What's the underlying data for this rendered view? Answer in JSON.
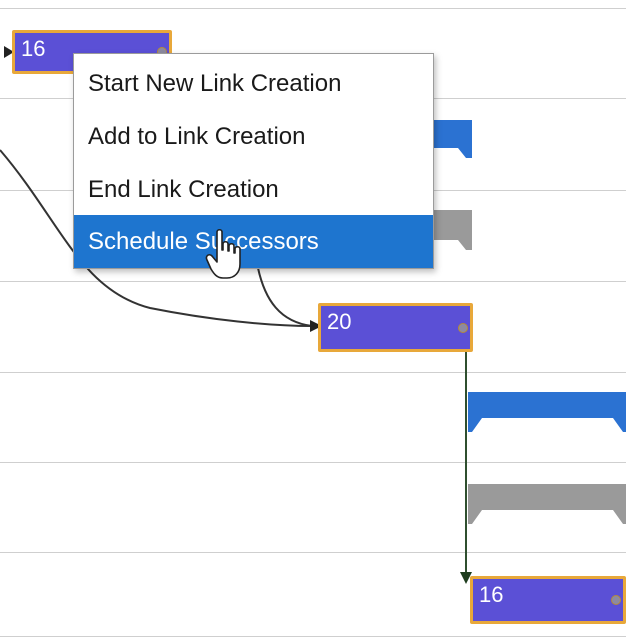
{
  "context_menu": {
    "items": [
      {
        "label": "Start New Link Creation"
      },
      {
        "label": "Add to Link Creation"
      },
      {
        "label": "End Link Creation"
      },
      {
        "label": "Schedule Successors"
      }
    ],
    "selected_index": 3
  },
  "tasks": [
    {
      "label": "16"
    },
    {
      "label": "20"
    },
    {
      "label": "16"
    }
  ],
  "colors": {
    "task_fill": "#5b50d6",
    "task_border": "#e8a83a",
    "summary_blue": "#2b72d2",
    "summary_gray": "#9a9a9a",
    "menu_highlight": "#1e75cf",
    "gridline": "#cfcfcf",
    "link_line": "#333333"
  },
  "icons": [
    "hand-pointer-cursor-icon",
    "link-arrowhead-icon",
    "task-link-handle-icon"
  ]
}
